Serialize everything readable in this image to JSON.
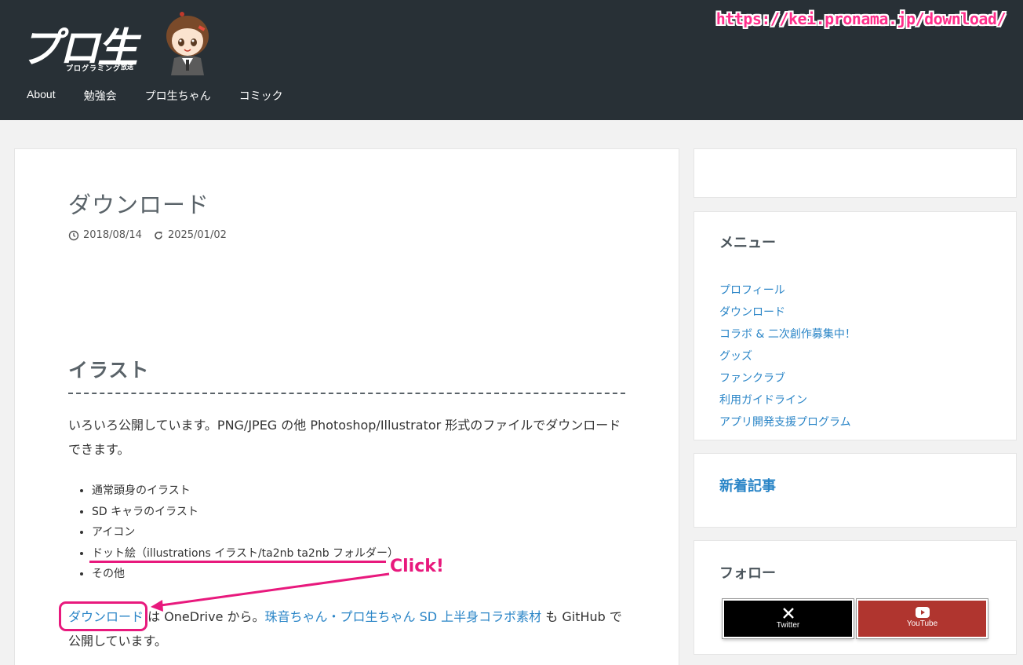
{
  "header": {
    "logo_text": "プロ生",
    "logo_sub": "プログラミング",
    "logo_sub2": "放送",
    "url": "https://kei.pronama.jp/download/"
  },
  "nav": {
    "items": [
      "About",
      "勉強会",
      "プロ生ちゃん",
      "コミック"
    ]
  },
  "article": {
    "title": "ダウンロード",
    "published": "2018/08/14",
    "updated": "2025/01/02",
    "section_heading": "イラスト",
    "paragraph": "いろいろ公開しています。PNG/JPEG の他 Photoshop/Illustrator 形式のファイルでダウンロードできます。",
    "list": [
      "通常頭身のイラスト",
      "SD キャラのイラスト",
      "アイコン",
      "ドット絵（illustrations イラスト/ta2nb ta2nb フォルダー）",
      "その他"
    ],
    "p2_link1": "ダウンロード",
    "p2_text1": " は OneDrive から。",
    "p2_link2": "珠音ちゃん・プロ生ちゃん SD 上半身コラボ素材",
    "p2_text2": " も GitHub で公開しています。"
  },
  "annotation": {
    "click_label": "Click!"
  },
  "sidebar": {
    "menu_title": "メニュー",
    "menu_items": [
      "プロフィール",
      "ダウンロード",
      "コラボ & 二次創作募集中！",
      "グッズ",
      "ファンクラブ",
      "利用ガイドライン",
      "アプリ開発支援プログラム"
    ],
    "new_posts_title": "新着記事",
    "follow_title": "フォロー",
    "twitter_label": "Twitter",
    "youtube_label": "YouTube"
  }
}
